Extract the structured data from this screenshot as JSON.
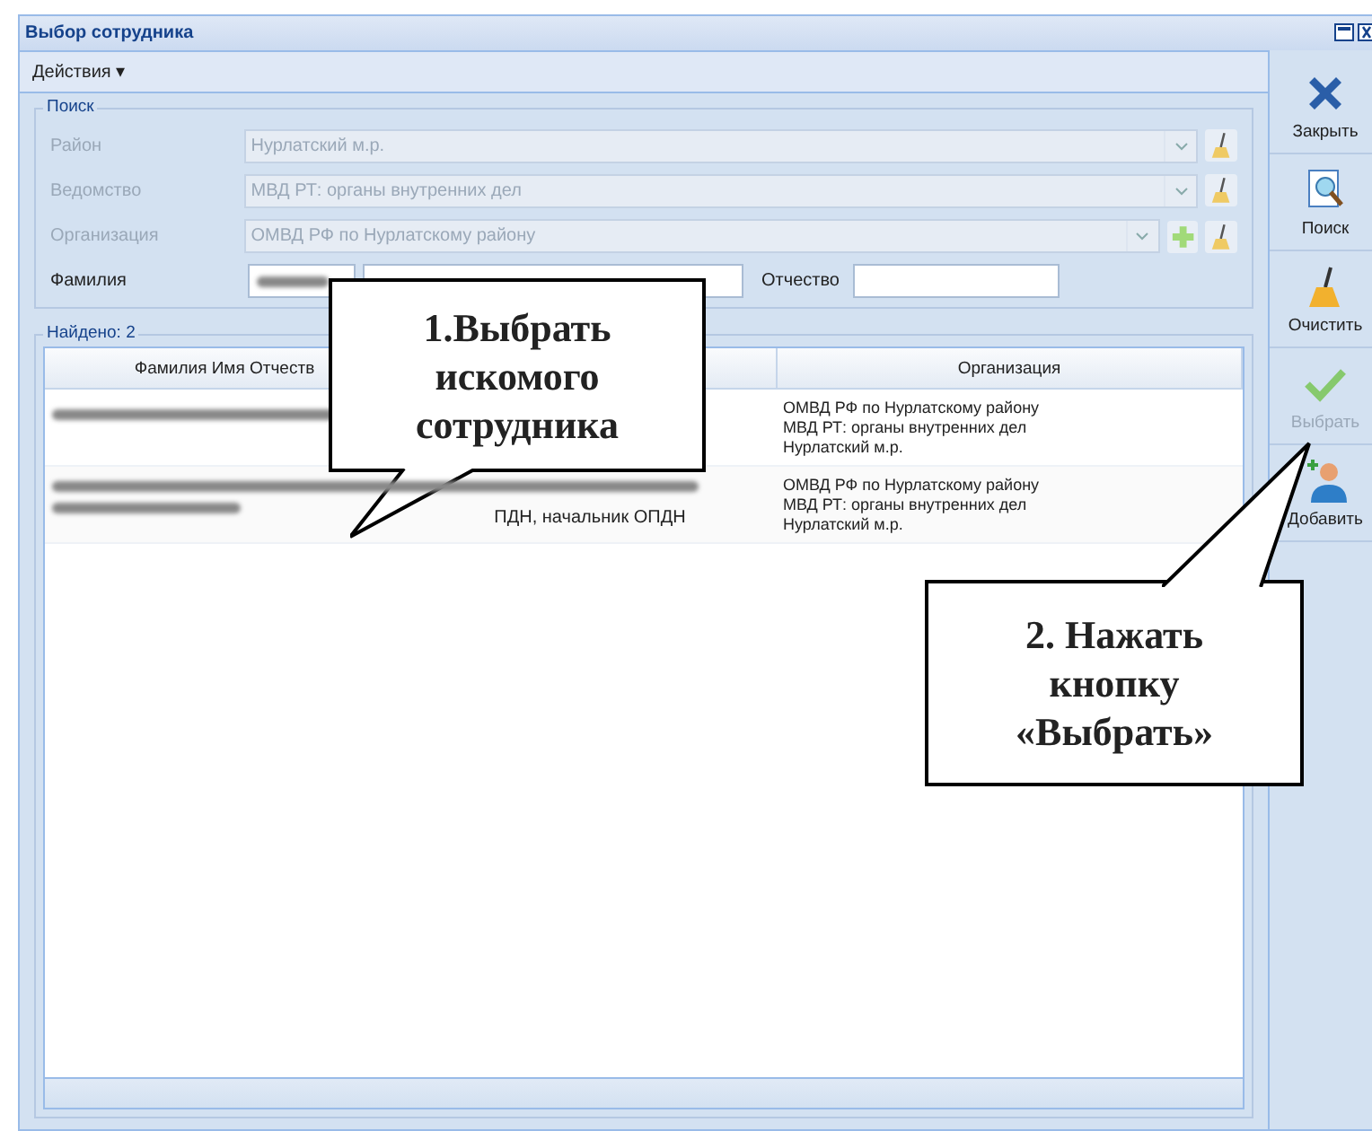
{
  "window": {
    "title": "Выбор сотрудника"
  },
  "menu": {
    "label": "Действия ▾"
  },
  "search": {
    "legend": "Поиск",
    "fields": [
      {
        "label": "Район",
        "value": "Нурлатский м.р.",
        "disabled": true,
        "add": false
      },
      {
        "label": "Ведомство",
        "value": "МВД РТ: органы внутренних дел",
        "disabled": true,
        "add": false
      },
      {
        "label": "Организация",
        "value": "ОМВД РФ по Нурлатскому району",
        "disabled": true,
        "add": true
      }
    ],
    "surname_label": "Фамилия",
    "patronymic_label": "Отчество"
  },
  "results": {
    "legend": "Найдено: 2",
    "columns": [
      "Фамилия Имя Отчеств",
      "",
      "Организация"
    ],
    "rows": [
      {
        "column_2": "",
        "organization": [
          "ОМВД РФ по Нурлатскому району",
          "МВД РТ: органы внутренних дел",
          "Нурлатский м.р."
        ],
        "selected": false
      },
      {
        "column_2": "ПДН, начальник ОПДН",
        "organization": [
          "ОМВД РФ по Нурлатскому району",
          "МВД РТ: органы внутренних дел",
          "Нурлатский м.р."
        ],
        "selected": false
      }
    ]
  },
  "toolbar": [
    {
      "kind": "close",
      "label": "Закрыть",
      "disabled": false
    },
    {
      "kind": "search",
      "label": "Поиск",
      "disabled": false
    },
    {
      "kind": "clear",
      "label": "Очистить",
      "disabled": false
    },
    {
      "kind": "select",
      "label": "Выбрать",
      "disabled": true
    },
    {
      "kind": "add",
      "label": "Добавить",
      "disabled": false
    }
  ],
  "callouts": [
    {
      "text": "1.Выбрать искомого сотрудника"
    },
    {
      "text": "2. Нажать кнопку «Выбрать»"
    }
  ]
}
